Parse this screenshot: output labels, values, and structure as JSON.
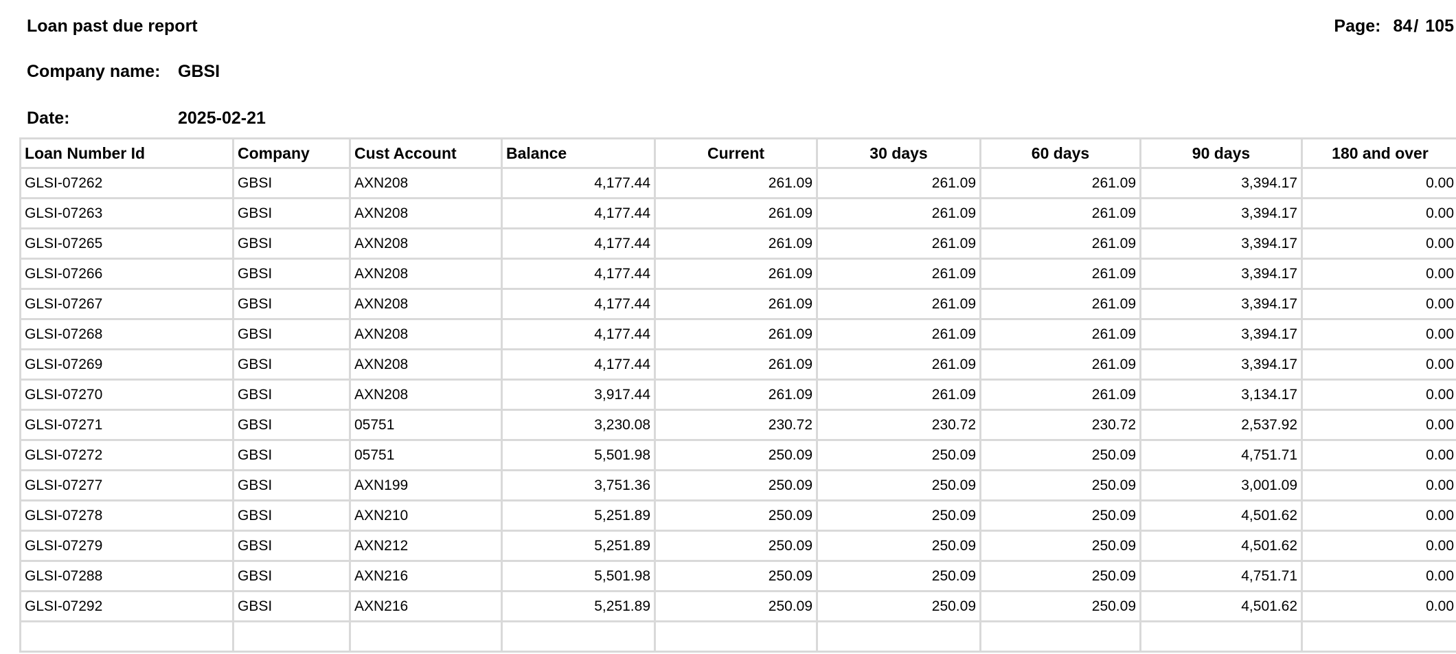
{
  "report": {
    "title": "Loan past due report",
    "page_label": "Page:",
    "page_current": "84",
    "page_separator": "/",
    "page_total": "105",
    "company_name_label": "Company name:",
    "company_name_value": "GBSI",
    "date_label": "Date:",
    "date_value": "2025-02-21"
  },
  "table": {
    "columns": [
      "Loan Number Id",
      "Company",
      "Cust Account",
      "Balance",
      "Current",
      "30 days",
      "60 days",
      "90 days",
      "180 and over"
    ],
    "rows": [
      [
        "GLSI-07262",
        "GBSI",
        "AXN208",
        "4,177.44",
        "261.09",
        "261.09",
        "261.09",
        "3,394.17",
        "0.00"
      ],
      [
        "GLSI-07263",
        "GBSI",
        "AXN208",
        "4,177.44",
        "261.09",
        "261.09",
        "261.09",
        "3,394.17",
        "0.00"
      ],
      [
        "GLSI-07265",
        "GBSI",
        "AXN208",
        "4,177.44",
        "261.09",
        "261.09",
        "261.09",
        "3,394.17",
        "0.00"
      ],
      [
        "GLSI-07266",
        "GBSI",
        "AXN208",
        "4,177.44",
        "261.09",
        "261.09",
        "261.09",
        "3,394.17",
        "0.00"
      ],
      [
        "GLSI-07267",
        "GBSI",
        "AXN208",
        "4,177.44",
        "261.09",
        "261.09",
        "261.09",
        "3,394.17",
        "0.00"
      ],
      [
        "GLSI-07268",
        "GBSI",
        "AXN208",
        "4,177.44",
        "261.09",
        "261.09",
        "261.09",
        "3,394.17",
        "0.00"
      ],
      [
        "GLSI-07269",
        "GBSI",
        "AXN208",
        "4,177.44",
        "261.09",
        "261.09",
        "261.09",
        "3,394.17",
        "0.00"
      ],
      [
        "GLSI-07270",
        "GBSI",
        "AXN208",
        "3,917.44",
        "261.09",
        "261.09",
        "261.09",
        "3,134.17",
        "0.00"
      ],
      [
        "GLSI-07271",
        "GBSI",
        "05751",
        "3,230.08",
        "230.72",
        "230.72",
        "230.72",
        "2,537.92",
        "0.00"
      ],
      [
        "GLSI-07272",
        "GBSI",
        "05751",
        "5,501.98",
        "250.09",
        "250.09",
        "250.09",
        "4,751.71",
        "0.00"
      ],
      [
        "GLSI-07277",
        "GBSI",
        "AXN199",
        "3,751.36",
        "250.09",
        "250.09",
        "250.09",
        "3,001.09",
        "0.00"
      ],
      [
        "GLSI-07278",
        "GBSI",
        "AXN210",
        "5,251.89",
        "250.09",
        "250.09",
        "250.09",
        "4,501.62",
        "0.00"
      ],
      [
        "GLSI-07279",
        "GBSI",
        "AXN212",
        "5,251.89",
        "250.09",
        "250.09",
        "250.09",
        "4,501.62",
        "0.00"
      ],
      [
        "GLSI-07288",
        "GBSI",
        "AXN216",
        "5,501.98",
        "250.09",
        "250.09",
        "250.09",
        "4,751.71",
        "0.00"
      ],
      [
        "GLSI-07292",
        "GBSI",
        "AXN216",
        "5,251.89",
        "250.09",
        "250.09",
        "250.09",
        "4,501.62",
        "0.00"
      ],
      [
        "",
        "",
        "",
        "",
        "",
        "",
        "",
        "",
        ""
      ]
    ]
  }
}
